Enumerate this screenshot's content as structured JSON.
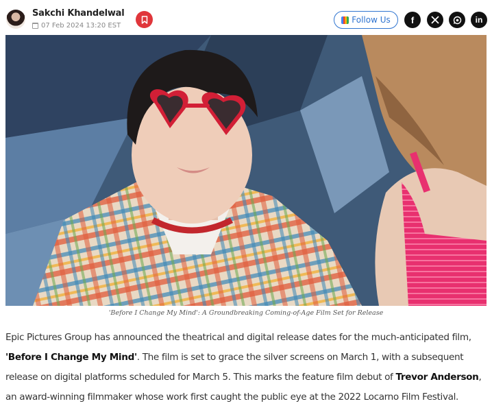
{
  "author": {
    "name": "Sakchi Khandelwal",
    "date": "07 Feb 2024 13:20 EST"
  },
  "actions": {
    "follow_label": "Follow Us",
    "social": [
      "facebook-icon",
      "x-icon",
      "whatsapp-icon",
      "linkedin-icon"
    ]
  },
  "image": {
    "caption": "'Before I Change My Mind': A Groundbreaking Coming-of-Age Film Set for Release"
  },
  "article": {
    "p1_a": "Epic Pictures Group has announced the theatrical and digital release dates for the much-anticipated film, ",
    "p1_title": "'Before I Change My Mind'",
    "p1_b": ". The film is set to grace the silver screens on March 1, with a subsequent release on digital platforms scheduled for March 5. This marks the feature film debut of ",
    "p1_name": "Trevor Anderson",
    "p1_c": ", an award-winning filmmaker whose work first caught the public eye at the 2022 Locarno Film Festival."
  },
  "colors": {
    "bookmark": "#e0363b",
    "follow": "#2f74d0"
  }
}
